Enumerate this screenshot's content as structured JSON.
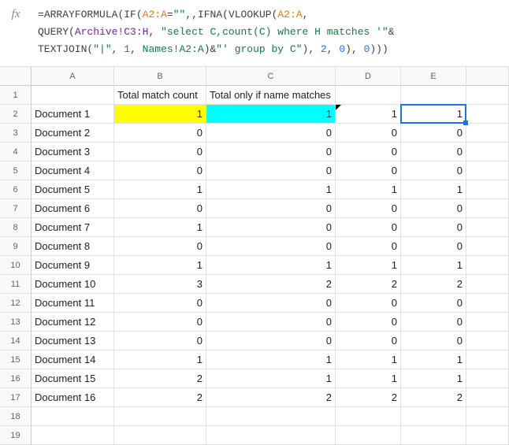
{
  "formula_bar": {
    "fx_label": "fx",
    "line1_eq": "=",
    "line1_arrayformula": "ARRAYFORMULA",
    "line1_open": "(",
    "line1_if": "IF",
    "line1_open2": "(",
    "line1_ref1": "A2:A",
    "line1_eq2": "=",
    "line1_quote": "\"\"",
    "line1_comma": ",,",
    "line1_ifna": "IFNA",
    "line1_open3": "(",
    "line1_vlookup": "VLOOKUP",
    "line1_open4": "(",
    "line1_ref2": "A2:A",
    "line1_comma2": ",",
    "line2_query": "QUERY",
    "line2_open": "(",
    "line2_ref": "Archive!C3:H",
    "line2_comma": ", ",
    "line2_str1": "\"select C,count(C) where H matches '\"",
    "line2_amp": "&",
    "line3_textjoin": "TEXTJOIN",
    "line3_open": "(",
    "line3_pipe": "\"|\"",
    "line3_comma1": ", ",
    "line3_one": "1",
    "line3_comma2": ", ",
    "line3_ref": "Names!A2:A",
    "line3_close": ")&",
    "line3_str": "\"' group by C\"",
    "line3_close2": "), ",
    "line3_two": "2",
    "line3_comma3": ", ",
    "line3_zero": "0",
    "line3_close3": "), ",
    "line3_zero2": "0",
    "line3_close4": ")))"
  },
  "columns": [
    "A",
    "B",
    "C",
    "D",
    "E"
  ],
  "headers": {
    "B": "Total match count",
    "C": "Total only if name matches"
  },
  "rows": [
    {
      "n": "1",
      "A": "",
      "B": "Total match count",
      "C": "Total only if name matches",
      "D": "",
      "E": ""
    },
    {
      "n": "2",
      "A": "Document 1",
      "B": "1",
      "C": "1",
      "D": "1",
      "E": "1",
      "hlB": "yellow",
      "hlC": "cyan",
      "noteD": true,
      "selE": true
    },
    {
      "n": "3",
      "A": "Document 2",
      "B": "0",
      "C": "0",
      "D": "0",
      "E": "0"
    },
    {
      "n": "4",
      "A": "Document 3",
      "B": "0",
      "C": "0",
      "D": "0",
      "E": "0"
    },
    {
      "n": "5",
      "A": "Document 4",
      "B": "0",
      "C": "0",
      "D": "0",
      "E": "0"
    },
    {
      "n": "6",
      "A": "Document 5",
      "B": "1",
      "C": "1",
      "D": "1",
      "E": "1"
    },
    {
      "n": "7",
      "A": "Document 6",
      "B": "0",
      "C": "0",
      "D": "0",
      "E": "0"
    },
    {
      "n": "8",
      "A": "Document 7",
      "B": "1",
      "C": "0",
      "D": "0",
      "E": "0"
    },
    {
      "n": "9",
      "A": "Document 8",
      "B": "0",
      "C": "0",
      "D": "0",
      "E": "0"
    },
    {
      "n": "10",
      "A": "Document 9",
      "B": "1",
      "C": "1",
      "D": "1",
      "E": "1"
    },
    {
      "n": "11",
      "A": "Document 10",
      "B": "3",
      "C": "2",
      "D": "2",
      "E": "2"
    },
    {
      "n": "12",
      "A": "Document 11",
      "B": "0",
      "C": "0",
      "D": "0",
      "E": "0"
    },
    {
      "n": "13",
      "A": "Document 12",
      "B": "0",
      "C": "0",
      "D": "0",
      "E": "0"
    },
    {
      "n": "14",
      "A": "Document 13",
      "B": "0",
      "C": "0",
      "D": "0",
      "E": "0"
    },
    {
      "n": "15",
      "A": "Document 14",
      "B": "1",
      "C": "1",
      "D": "1",
      "E": "1"
    },
    {
      "n": "16",
      "A": "Document 15",
      "B": "2",
      "C": "1",
      "D": "1",
      "E": "1"
    },
    {
      "n": "17",
      "A": "Document 16",
      "B": "2",
      "C": "2",
      "D": "2",
      "E": "2"
    },
    {
      "n": "18",
      "A": "",
      "B": "",
      "C": "",
      "D": "",
      "E": ""
    },
    {
      "n": "19",
      "A": "",
      "B": "",
      "C": "",
      "D": "",
      "E": ""
    }
  ]
}
